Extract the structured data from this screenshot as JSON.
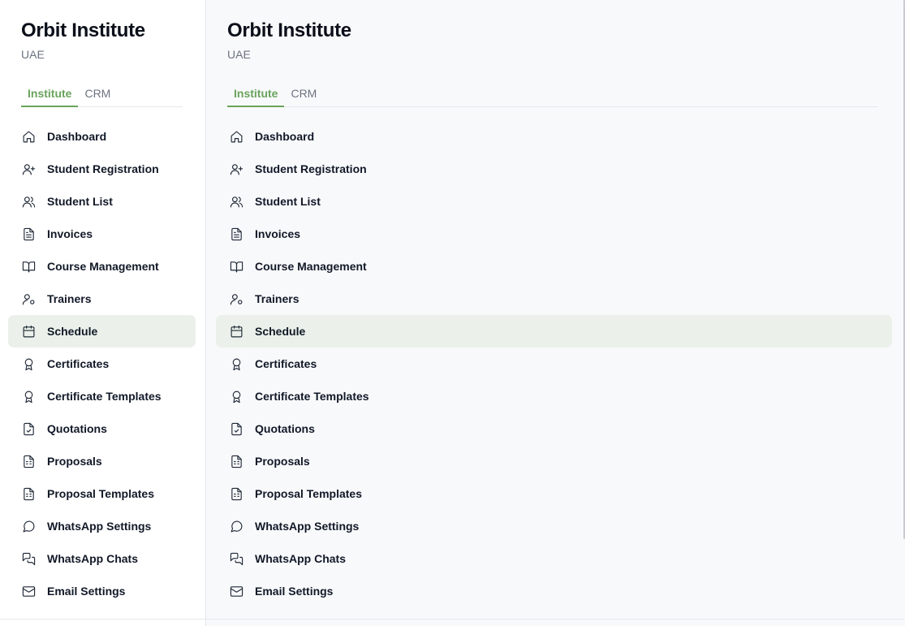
{
  "institute": {
    "name": "Orbit Institute",
    "region": "UAE"
  },
  "tabs": [
    {
      "label": "Institute",
      "active": true
    },
    {
      "label": "CRM",
      "active": false
    }
  ],
  "nav": [
    {
      "label": "Dashboard",
      "icon": "home-icon"
    },
    {
      "label": "Student Registration",
      "icon": "user-plus-icon"
    },
    {
      "label": "Student List",
      "icon": "users-icon"
    },
    {
      "label": "Invoices",
      "icon": "file-text-icon"
    },
    {
      "label": "Course Management",
      "icon": "book-open-icon"
    },
    {
      "label": "Trainers",
      "icon": "user-cog-icon"
    },
    {
      "label": "Schedule",
      "icon": "calendar-icon",
      "active": true
    },
    {
      "label": "Certificates",
      "icon": "award-icon"
    },
    {
      "label": "Certificate Templates",
      "icon": "award-icon"
    },
    {
      "label": "Quotations",
      "icon": "file-check-icon"
    },
    {
      "label": "Proposals",
      "icon": "file-spreadsheet-icon"
    },
    {
      "label": "Proposal Templates",
      "icon": "file-spreadsheet-icon"
    },
    {
      "label": "WhatsApp Settings",
      "icon": "message-circle-icon"
    },
    {
      "label": "WhatsApp Chats",
      "icon": "messages-icon"
    },
    {
      "label": "Email Settings",
      "icon": "mail-icon"
    }
  ],
  "colors": {
    "accent": "#6aa35c",
    "active_bg": "#ebf1ea"
  }
}
